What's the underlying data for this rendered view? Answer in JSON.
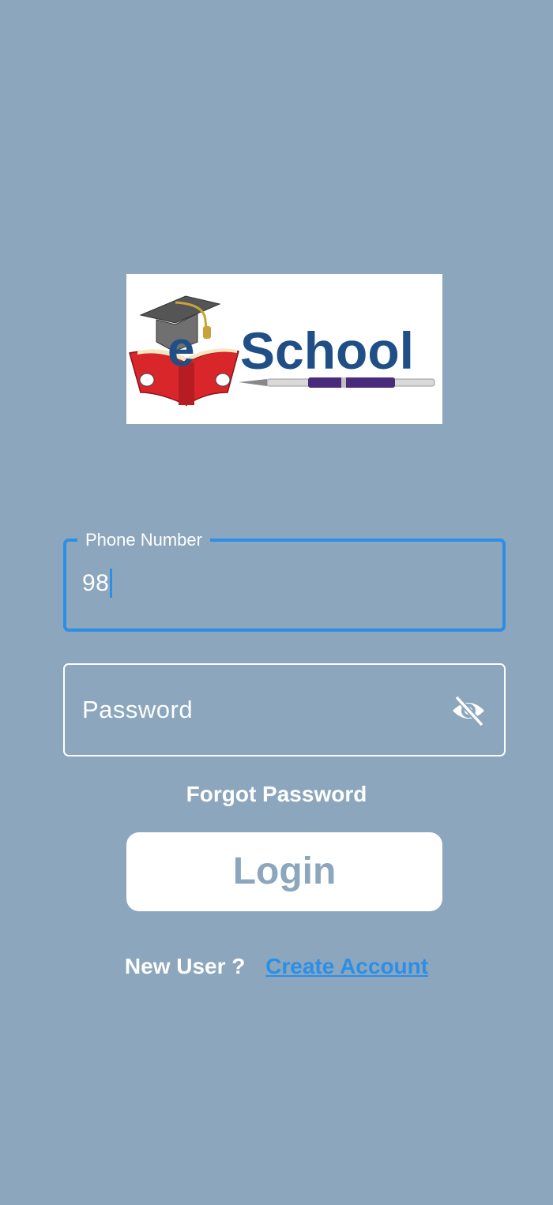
{
  "logo": {
    "text_e": "e",
    "text_school": "School"
  },
  "phone_field": {
    "label": "Phone Number",
    "value": "98"
  },
  "password_field": {
    "placeholder": "Password",
    "toggle_icon": "eye-off-icon"
  },
  "forgot_password": "Forgot Password",
  "login_button": "Login",
  "signup": {
    "prompt": "New User ?",
    "link": "Create Account"
  },
  "colors": {
    "background": "#8ba6bd",
    "accent": "#2b8fe8",
    "logo_blue": "#1f4f86",
    "book_red": "#d8262b"
  }
}
